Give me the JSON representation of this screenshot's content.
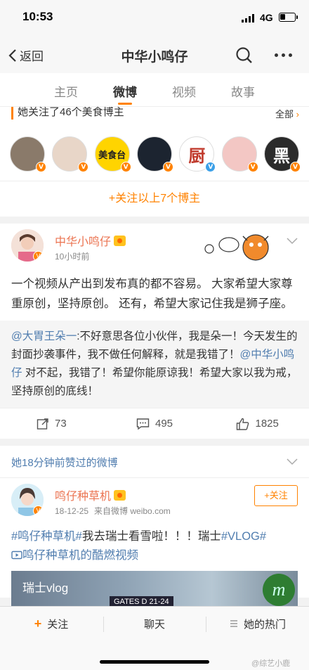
{
  "status_bar": {
    "time": "10:53",
    "network": "4G"
  },
  "nav": {
    "back_label": "返回",
    "title": "中华小鸣仔"
  },
  "tabs": [
    {
      "label": "主页",
      "active": false
    },
    {
      "label": "微博",
      "active": true
    },
    {
      "label": "视频",
      "active": false
    },
    {
      "label": "故事",
      "active": false
    }
  ],
  "follow_section": {
    "text": "她关注了46个美食博主",
    "all_label": "全部",
    "avatars": [
      {
        "name": "avatar-1",
        "color": "#8a7a6a",
        "badge": "#ff8200"
      },
      {
        "name": "avatar-2",
        "color": "#e8d6c8",
        "badge": "#ff8200"
      },
      {
        "name": "avatar-3",
        "color": "#ffd400",
        "badge": "#ff8200",
        "text": "美食台"
      },
      {
        "name": "avatar-4",
        "color": "#1c2430",
        "badge": "#ff8200"
      },
      {
        "name": "avatar-5",
        "color": "#ffffff",
        "badge": "#3ca0e8",
        "text": "厨"
      },
      {
        "name": "avatar-6",
        "color": "#f3c7c4",
        "badge": "#ff8200"
      },
      {
        "name": "avatar-7",
        "color": "#2b2b2b",
        "badge": "#ff8200",
        "text": "黑"
      }
    ],
    "follow_all_label": "+关注以上7个博主"
  },
  "post1": {
    "username": "中华小鸣仔",
    "time": "10小时前",
    "text": "一个视频从产出到发布真的都不容易。 大家希望大家尊重原创，坚持原创。 还有，希望大家记住我是狮子座。",
    "repost_mention": "@大胃王朵一",
    "repost_text_a": ":不好意思各位小伙伴，我是朵一！今天发生的封面抄袭事件，我不做任何解释，就是我错了！",
    "repost_mention2": "@中华小鸣仔",
    "repost_text_b": " 对不起，我错了！希望你能原谅我！希望大家以我为戒，坚持原创的底线！",
    "reposts": "73",
    "comments": "495",
    "likes": "1825"
  },
  "liked_section": {
    "title": "她18分钟前赞过的微博"
  },
  "post2": {
    "username": "鸣仔种草机",
    "date": "18-12-25",
    "source": "来自微博 weibo.com",
    "follow_label": "+关注",
    "tag1": "#鸣仔种草机#",
    "text1": "我去瑞士看雪啦！！！瑞士",
    "tag2": "#VLOG#",
    "video_link": "鸣仔种草机的酷燃视频",
    "video_title": "瑞士vlog",
    "video_gate": "GATES D 21-24"
  },
  "bottom_bar": {
    "follow": "关注",
    "chat": "聊天",
    "hot": "她的热门"
  },
  "watermark": "@综艺小鹿",
  "colors": {
    "accent": "#ff8200",
    "link": "#507daf",
    "username": "#eb7350"
  }
}
